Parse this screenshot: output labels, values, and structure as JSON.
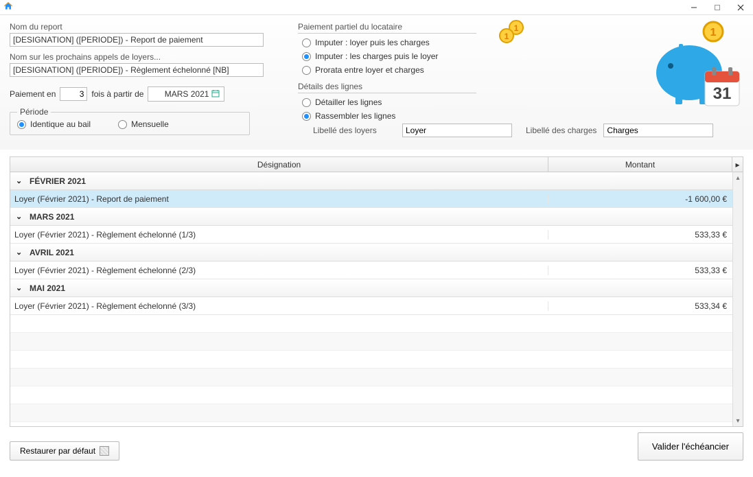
{
  "titlebar": {},
  "left": {
    "report_name_label": "Nom du report",
    "report_name_value": "[DESIGNATION] ([PERIODE]) - Report de paiement",
    "next_calls_label": "Nom sur les prochains appels de loyers...",
    "next_calls_value": "[DESIGNATION] ([PERIODE]) - Règlement échelonné [NB]",
    "pay_in_prefix": "Paiement en",
    "pay_in_count": "3",
    "pay_in_mid": "fois à partir de",
    "pay_in_date": "MARS 2021",
    "period_legend": "Période",
    "period_opt1": "Identique au bail",
    "period_opt2": "Mensuelle"
  },
  "right": {
    "partial_title": "Paiement partiel du locataire",
    "partial_opt1": "Imputer : loyer puis les charges",
    "partial_opt2": "Imputer : les charges puis le loyer",
    "partial_opt3": "Prorata entre loyer et charges",
    "details_title": "Détails des lignes",
    "details_opt1": "Détailler les lignes",
    "details_opt2": "Rassembler les lignes",
    "lib_loyers_label": "Libellé des loyers",
    "lib_loyers_value": "Loyer",
    "lib_charges_label": "Libellé des charges",
    "lib_charges_value": "Charges"
  },
  "table": {
    "col_des": "Désignation",
    "col_mon": "Montant",
    "groups": [
      {
        "label": "FÉVRIER 2021",
        "rows": [
          {
            "des": "Loyer (Février 2021) - Report de paiement",
            "mon": "-1 600,00 €",
            "hl": true
          }
        ]
      },
      {
        "label": "MARS 2021",
        "rows": [
          {
            "des": "Loyer (Février 2021) - Règlement échelonné  (1/3)",
            "mon": "533,33 €",
            "hl": false
          }
        ]
      },
      {
        "label": "AVRIL 2021",
        "rows": [
          {
            "des": "Loyer (Février 2021) - Règlement échelonné  (2/3)",
            "mon": "533,33 €",
            "hl": false
          }
        ]
      },
      {
        "label": "MAI 2021",
        "rows": [
          {
            "des": "Loyer (Février 2021) - Règlement échelonné  (3/3)",
            "mon": "533,34 €",
            "hl": false
          }
        ]
      }
    ]
  },
  "footer": {
    "restore": "Restaurer par défaut",
    "validate": "Valider l'échéancier"
  }
}
